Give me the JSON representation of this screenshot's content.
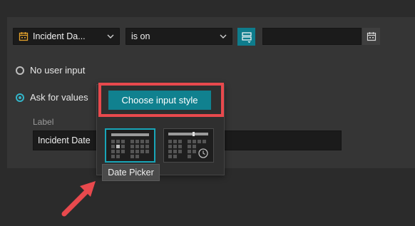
{
  "filter": {
    "field_label": "Incident Da...",
    "operator_label": "is on",
    "value": ""
  },
  "radios": [
    {
      "label": "No user input",
      "checked": false
    },
    {
      "label": "Ask for values",
      "checked": true
    }
  ],
  "label_section": {
    "heading": "Label",
    "value": "Incident Date"
  },
  "popover": {
    "button_label": "Choose input style",
    "tooltip": "Date Picker"
  },
  "colors": {
    "accent": "#10818f",
    "highlight": "#e8494d",
    "field_icon": "#e4a22b"
  },
  "icons": [
    "calendar-icon",
    "chevron-down-icon",
    "list-settings-icon",
    "date-picker-icon",
    "date-time-picker-icon",
    "arrow-icon"
  ]
}
